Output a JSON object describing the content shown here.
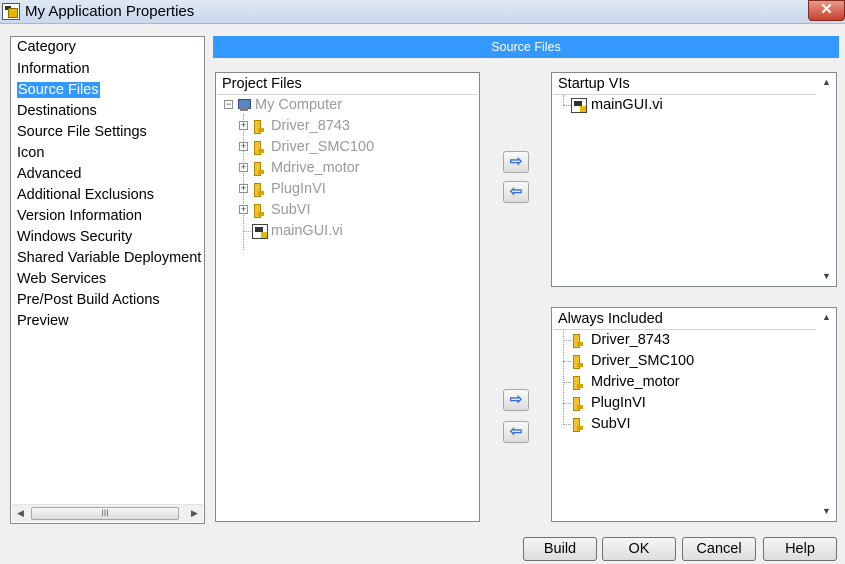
{
  "window": {
    "title": "My Application Properties",
    "close_label": "✕"
  },
  "category": {
    "header": "Category",
    "items": [
      {
        "label": "Information",
        "selected": false
      },
      {
        "label": "Source Files",
        "selected": true
      },
      {
        "label": "Destinations",
        "selected": false
      },
      {
        "label": "Source File Settings",
        "selected": false
      },
      {
        "label": "Icon",
        "selected": false
      },
      {
        "label": "Advanced",
        "selected": false
      },
      {
        "label": "Additional Exclusions",
        "selected": false
      },
      {
        "label": "Version Information",
        "selected": false
      },
      {
        "label": "Windows Security",
        "selected": false
      },
      {
        "label": "Shared Variable Deployment",
        "selected": false
      },
      {
        "label": "Web Services",
        "selected": false
      },
      {
        "label": "Pre/Post Build Actions",
        "selected": false
      },
      {
        "label": "Preview",
        "selected": false
      }
    ],
    "scroll_thumb": "III"
  },
  "banner": {
    "title": "Source Files"
  },
  "project_files": {
    "header": "Project Files",
    "root": "My Computer",
    "folders": [
      "Driver_8743",
      "Driver_SMC100",
      "Mdrive_motor",
      "PlugInVI",
      "SubVI"
    ],
    "file": "mainGUI.vi"
  },
  "startup_vis": {
    "header": "Startup VIs",
    "items": [
      "mainGUI.vi"
    ]
  },
  "always_included": {
    "header": "Always Included",
    "items": [
      "Driver_8743",
      "Driver_SMC100",
      "Mdrive_motor",
      "PlugInVI",
      "SubVI"
    ]
  },
  "transfer": {
    "add_symbol": "⇨",
    "remove_symbol": "⇦"
  },
  "buttons": {
    "build": "Build",
    "ok": "OK",
    "cancel": "Cancel",
    "help": "Help"
  },
  "colors": {
    "selection": "#3399ff",
    "banner": "#3399ff",
    "disabled_text": "#9a9a9a"
  }
}
